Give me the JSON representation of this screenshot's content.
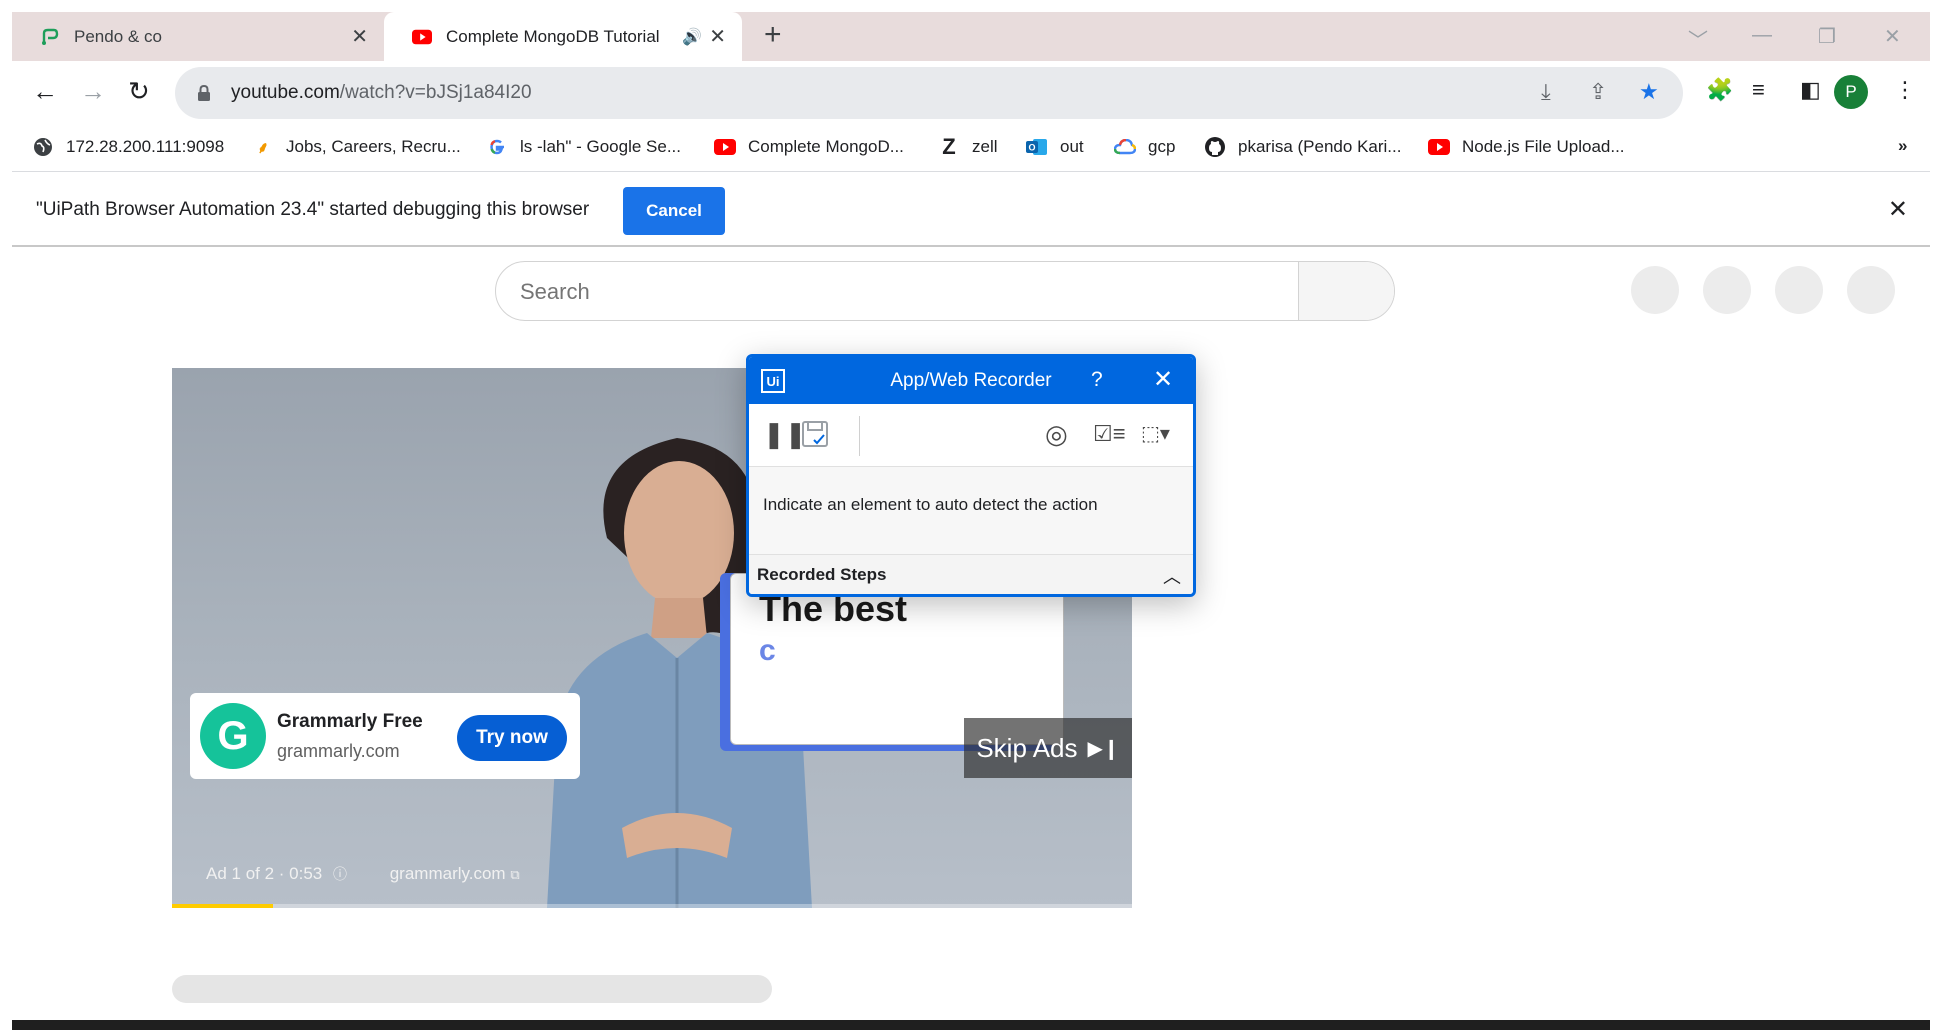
{
  "tabs": [
    {
      "title": "Pendo & co",
      "active": false
    },
    {
      "title": "Complete MongoDB Tutorial",
      "active": true
    }
  ],
  "toolbar": {
    "url_host": "youtube.com",
    "url_path": "/watch?v=bJSj1a84I20",
    "profile_initial": "P"
  },
  "bookmarks": [
    {
      "label": "172.28.200.111:9098",
      "icon": "globe-icon"
    },
    {
      "label": "Jobs, Careers, Recru...",
      "icon": "feather-icon"
    },
    {
      "label": "ls -lah\" - Google Se...",
      "icon": "google-icon"
    },
    {
      "label": "Complete MongoD...",
      "icon": "youtube-icon"
    },
    {
      "label": "zell",
      "icon": "zell-icon"
    },
    {
      "label": "out",
      "icon": "outlook-icon"
    },
    {
      "label": "gcp",
      "icon": "cloud-icon"
    },
    {
      "label": "pkarisa (Pendo Kari...",
      "icon": "github-icon"
    },
    {
      "label": "Node.js File Upload...",
      "icon": "youtube-icon"
    }
  ],
  "infobar": {
    "message": "\"UiPath Browser Automation 23.4\" started debugging this browser",
    "cancel_label": "Cancel"
  },
  "youtube": {
    "search_placeholder": "Search"
  },
  "ad": {
    "advertiser": "Grammarly Free",
    "domain": "grammarly.com",
    "cta": "Try now",
    "promo_heading": "The best",
    "promo_sub": "c",
    "skip_label": "Skip Ads",
    "ad_counter": "Ad 1 of 2 · 0:53",
    "ad_domain": "grammarly.com",
    "progress_fraction": 0.105
  },
  "recorder": {
    "title": "App/Web Recorder",
    "help": "?",
    "message": "Indicate an element to auto detect the action",
    "steps_label": "Recorded Steps"
  },
  "colors": {
    "chrome_tabstrip": "#e8dcdc",
    "chrome_blue": "#1a73e8",
    "uipath_blue": "#0067df",
    "youtube_red": "#ff0000",
    "grammarly_green": "#15c39a",
    "cta_blue": "#065fd4",
    "ad_progress": "#ffcc00"
  }
}
